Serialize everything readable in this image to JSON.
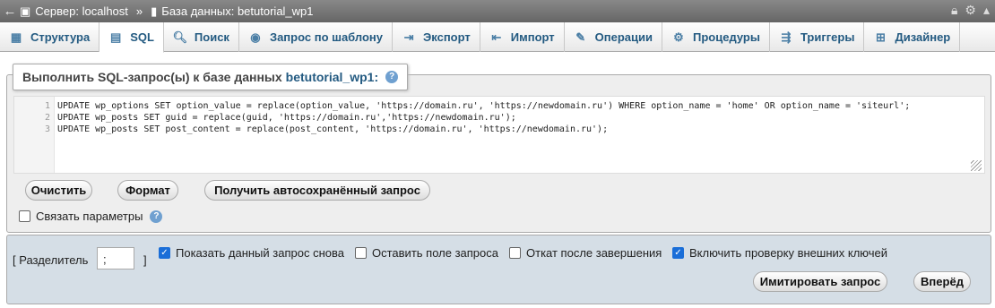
{
  "topbar": {
    "back": "←",
    "server_label": "Сервер: localhost",
    "separator": "»",
    "db_label": "База данных: betutorial_wp1"
  },
  "tabs": [
    {
      "label": "Структура",
      "icon": "structure-icon"
    },
    {
      "label": "SQL",
      "icon": "sql-icon"
    },
    {
      "label": "Поиск",
      "icon": "search-icon"
    },
    {
      "label": "Запрос по шаблону",
      "icon": "query-icon"
    },
    {
      "label": "Экспорт",
      "icon": "export-icon"
    },
    {
      "label": "Импорт",
      "icon": "import-icon"
    },
    {
      "label": "Операции",
      "icon": "wrench-icon"
    },
    {
      "label": "Процедуры",
      "icon": "routines-icon"
    },
    {
      "label": "Триггеры",
      "icon": "triggers-icon"
    },
    {
      "label": "Дизайнер",
      "icon": "designer-icon"
    }
  ],
  "legend": {
    "prefix": "Выполнить SQL-запрос(ы) к базе данных",
    "db": "betutorial_wp1:"
  },
  "editor": {
    "lines": [
      {
        "n": "1",
        "text": "UPDATE wp_options SET option_value = replace(option_value, 'https://domain.ru', 'https://newdomain.ru') WHERE option_name = 'home' OR option_name = 'siteurl';"
      },
      {
        "n": "2",
        "text": "UPDATE wp_posts SET guid = replace(guid, 'https://domain.ru','https://newdomain.ru');"
      },
      {
        "n": "3",
        "text": "UPDATE wp_posts SET post_content = replace(post_content, 'https://domain.ru', 'https://newdomain.ru');"
      }
    ]
  },
  "buttons": {
    "clear": "Очистить",
    "format": "Формат",
    "autosave": "Получить автосохранённый запрос",
    "simulate": "Имитировать запрос",
    "go": "Вперёд"
  },
  "bind_params": "Связать параметры",
  "delimiter": {
    "label_open": "[ Разделитель",
    "value": ";",
    "label_close": "]"
  },
  "options": [
    {
      "label": "Показать данный запрос снова",
      "checked": true
    },
    {
      "label": "Оставить поле запроса",
      "checked": false
    },
    {
      "label": "Откат после завершения",
      "checked": false
    },
    {
      "label": "Включить проверку внешних ключей",
      "checked": true
    }
  ]
}
